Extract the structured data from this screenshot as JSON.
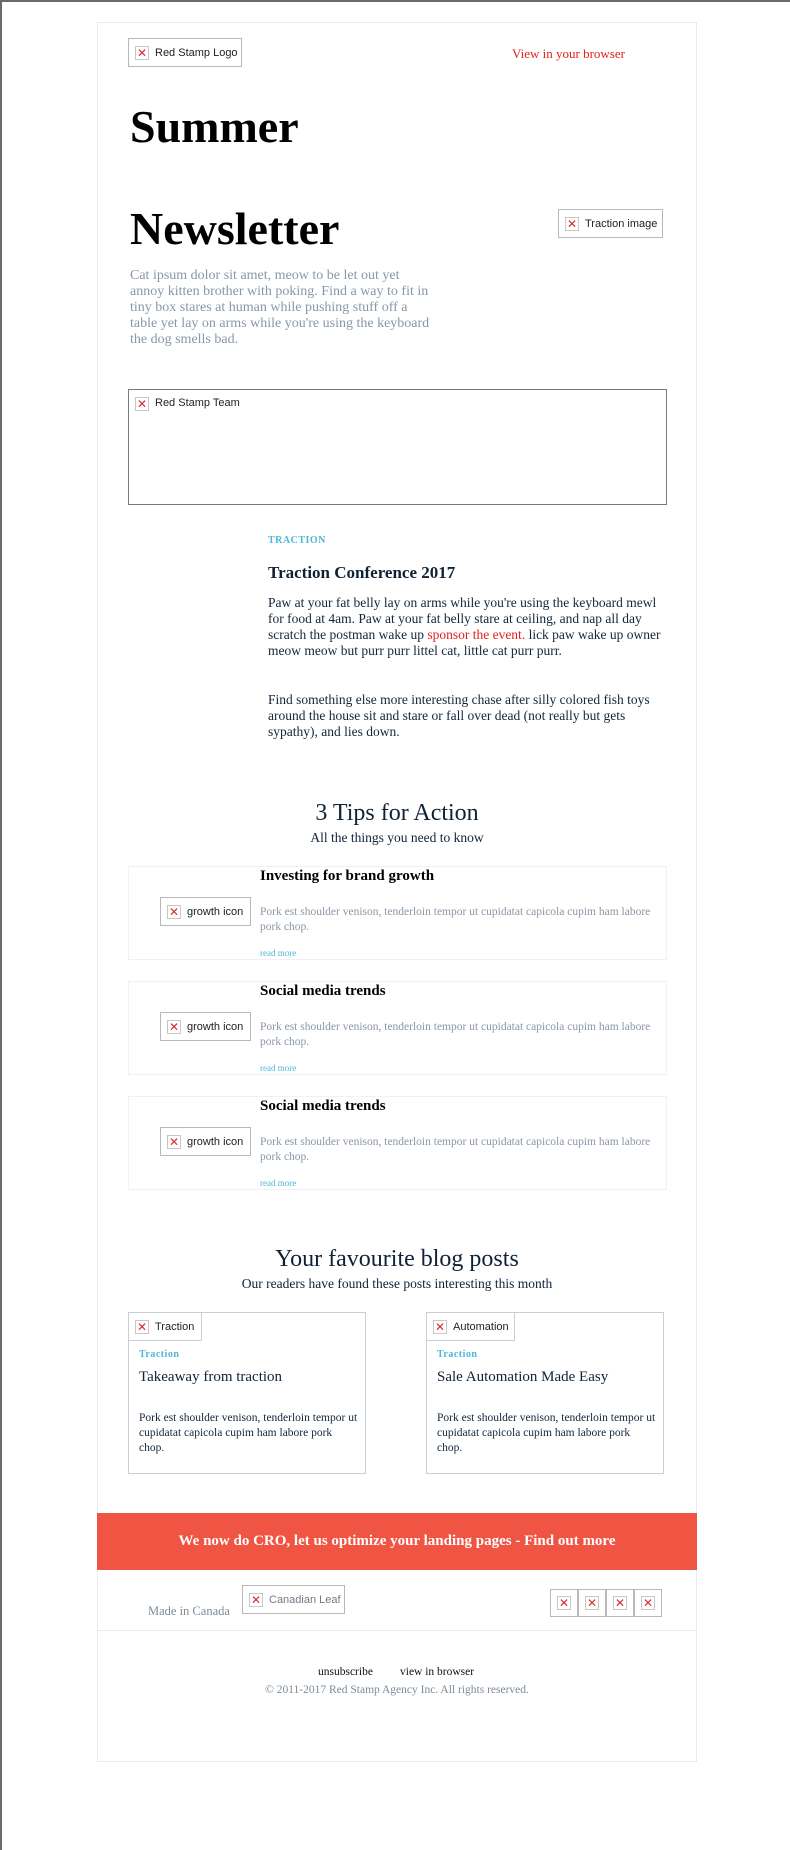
{
  "header": {
    "logo_alt": "Red Stamp Logo",
    "browser_link": "View in your browser"
  },
  "hero": {
    "title_line1": "Summer",
    "title_line2": "Newsletter",
    "copy": "Cat ipsum dolor sit amet, meow to be let out yet annoy kitten brother with poking. Find a way to fit in tiny box stares at human while pushing stuff off a table yet lay on arms while you're using the keyboard the dog smells bad.",
    "image_alt": "Traction image"
  },
  "team_image_alt": "Red Stamp Team",
  "feature": {
    "kicker": "TRACTION",
    "title": "Traction Conference 2017",
    "para1_before": "Paw at your fat belly lay on arms while you're using the keyboard mewl for food at 4am. Paw at your fat belly stare at ceiling, and nap all day scratch the postman wake up ",
    "para1_link": "sponsor the event.",
    "para1_after": " lick paw wake up owner meow meow but purr purr littel cat, little cat purr purr.",
    "para2": "Find something else more interesting chase after silly colored fish toys around the house sit and stare or fall over dead (not really but gets sypathy), and lies down."
  },
  "tips": {
    "title": "3 Tips for Action",
    "subtitle": "All the things you need to know",
    "items": [
      {
        "icon_alt": "growth icon",
        "title": "Investing for brand growth",
        "text": "Pork est shoulder venison, tenderloin tempor ut cupidatat capicola cupim ham labore pork chop.",
        "more": "read more"
      },
      {
        "icon_alt": "growth icon",
        "title": "Social media trends",
        "text": "Pork est shoulder venison, tenderloin tempor ut cupidatat capicola cupim ham labore pork chop.",
        "more": "read more"
      },
      {
        "icon_alt": "growth icon",
        "title": "Social media trends",
        "text": "Pork est shoulder venison, tenderloin tempor ut cupidatat capicola cupim ham labore pork chop.",
        "more": "read more"
      }
    ]
  },
  "blog": {
    "title": "Your favourite blog posts",
    "subtitle": "Our readers have found these posts interesting this month",
    "posts": [
      {
        "image_alt": "Traction",
        "kicker": "Traction",
        "title": "Takeaway from traction",
        "text": "Pork est shoulder venison, tenderloin tempor ut cupidatat capicola cupim ham labore pork chop."
      },
      {
        "image_alt": "Automation",
        "kicker": "Traction",
        "title": "Sale Automation Made Easy",
        "text": "Pork est shoulder venison, tenderloin tempor ut cupidatat capicola cupim ham labore pork chop."
      }
    ]
  },
  "cta": {
    "label": "We now do CRO, let us optimize your landing pages - Find out more"
  },
  "footer": {
    "made_in": "Made in Canada",
    "leaf_alt": "Canadian Leaf",
    "unsubscribe": "unsubscribe",
    "view_in_browser": "view in browser",
    "copyright": "© 2011-2017 Red Stamp Agency Inc. All rights reserved."
  },
  "colors": {
    "accent_red": "#f05443",
    "link_red": "#e02020",
    "kicker_blue": "#4db8d6",
    "band_bg": "#f5f8fc"
  },
  "icons": {
    "broken_image": "broken-image-icon"
  }
}
